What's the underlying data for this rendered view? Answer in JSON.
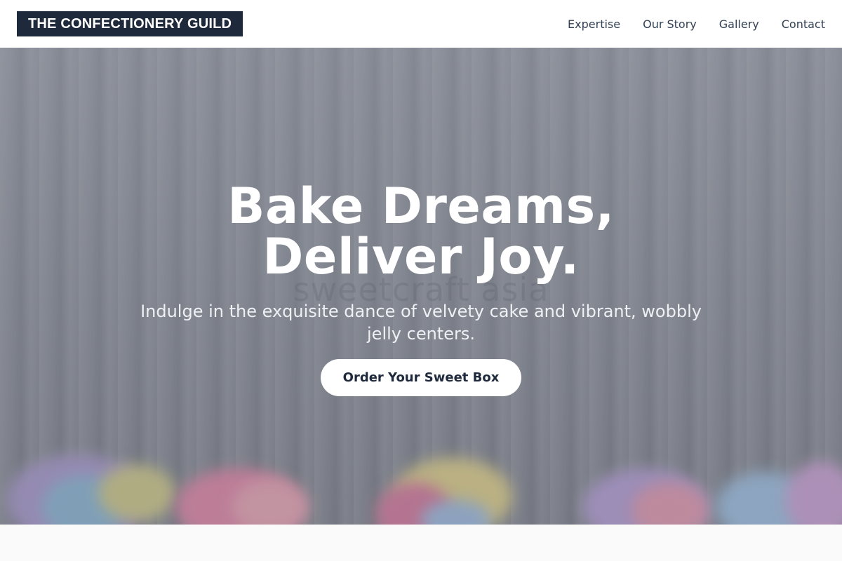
{
  "header": {
    "logo_text": "THE CONFECTIONERY GUILD",
    "nav_links": [
      "Expertise",
      "Our Story",
      "Gallery",
      "Contact"
    ]
  },
  "hero": {
    "title_line1": "Bake Dreams,",
    "title_line2": "Deliver Joy.",
    "watermark": "sweetcraft asia",
    "subtitle": "Indulge in the exquisite dance of velvety cake and vibrant, wobbly jelly centers.",
    "cta_label": "Order Your Sweet Box"
  },
  "colors": {
    "logo_background": "#1e293b",
    "nav_text": "#334155",
    "hero_text": "#ffffff",
    "cta_background": "#ffffff",
    "cta_text": "#1e293b"
  }
}
